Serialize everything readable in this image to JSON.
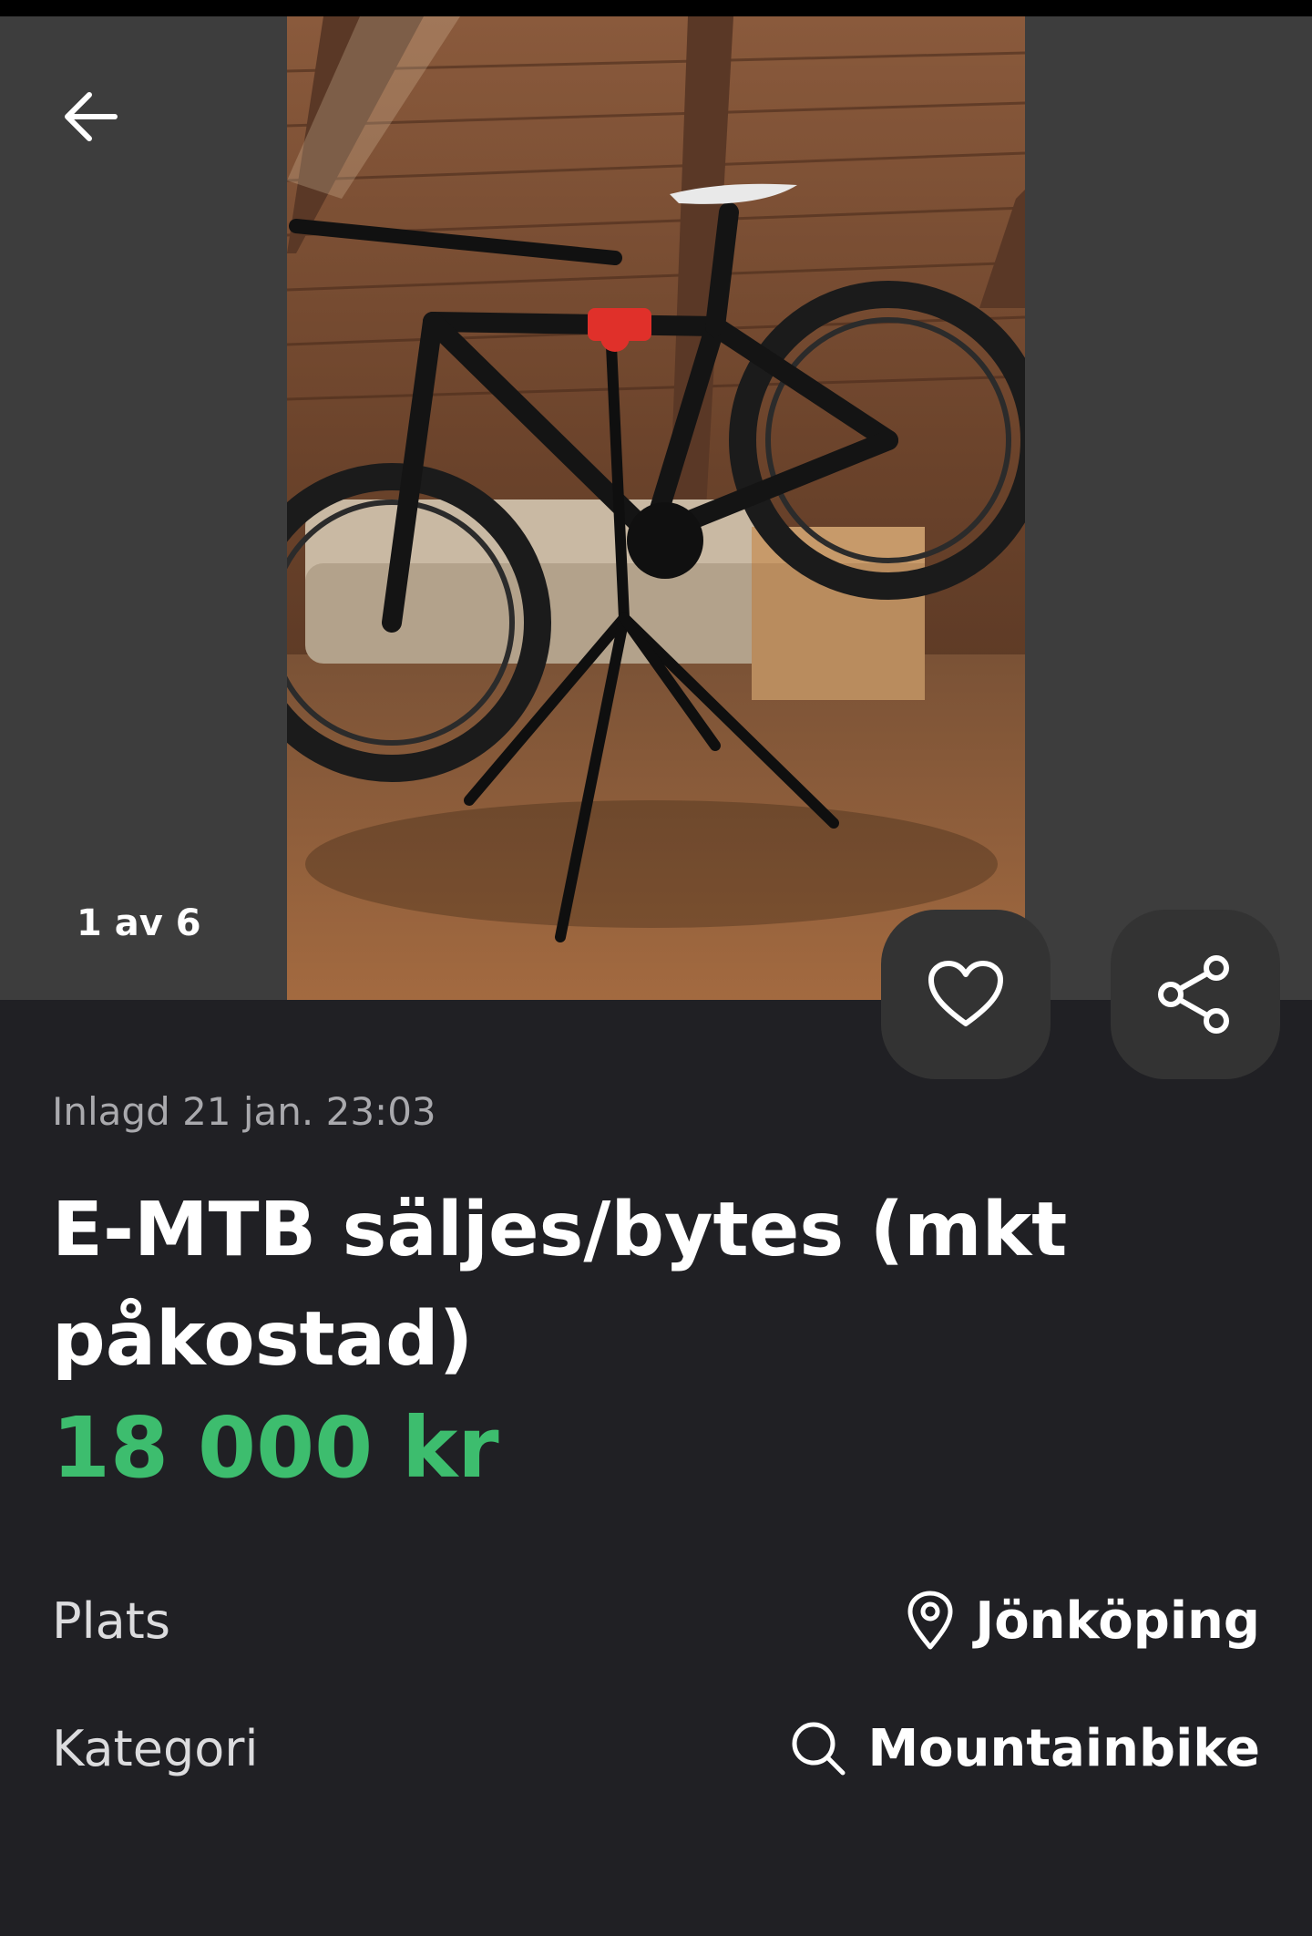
{
  "gallery": {
    "counter": "1 av 6"
  },
  "listing": {
    "posted": "Inlagd 21 jan. 23:03",
    "title": "E-MTB säljes/bytes (mkt påkostad)",
    "price": "18 000 kr"
  },
  "details": {
    "location": {
      "label": "Plats",
      "value": "Jönköping",
      "icon": "location-pin-icon"
    },
    "category": {
      "label": "Kategori",
      "value": "Mountainbike",
      "icon": "search-icon"
    }
  },
  "colors": {
    "background": "#202024",
    "price": "#3dbd6e",
    "button": "#333333"
  }
}
